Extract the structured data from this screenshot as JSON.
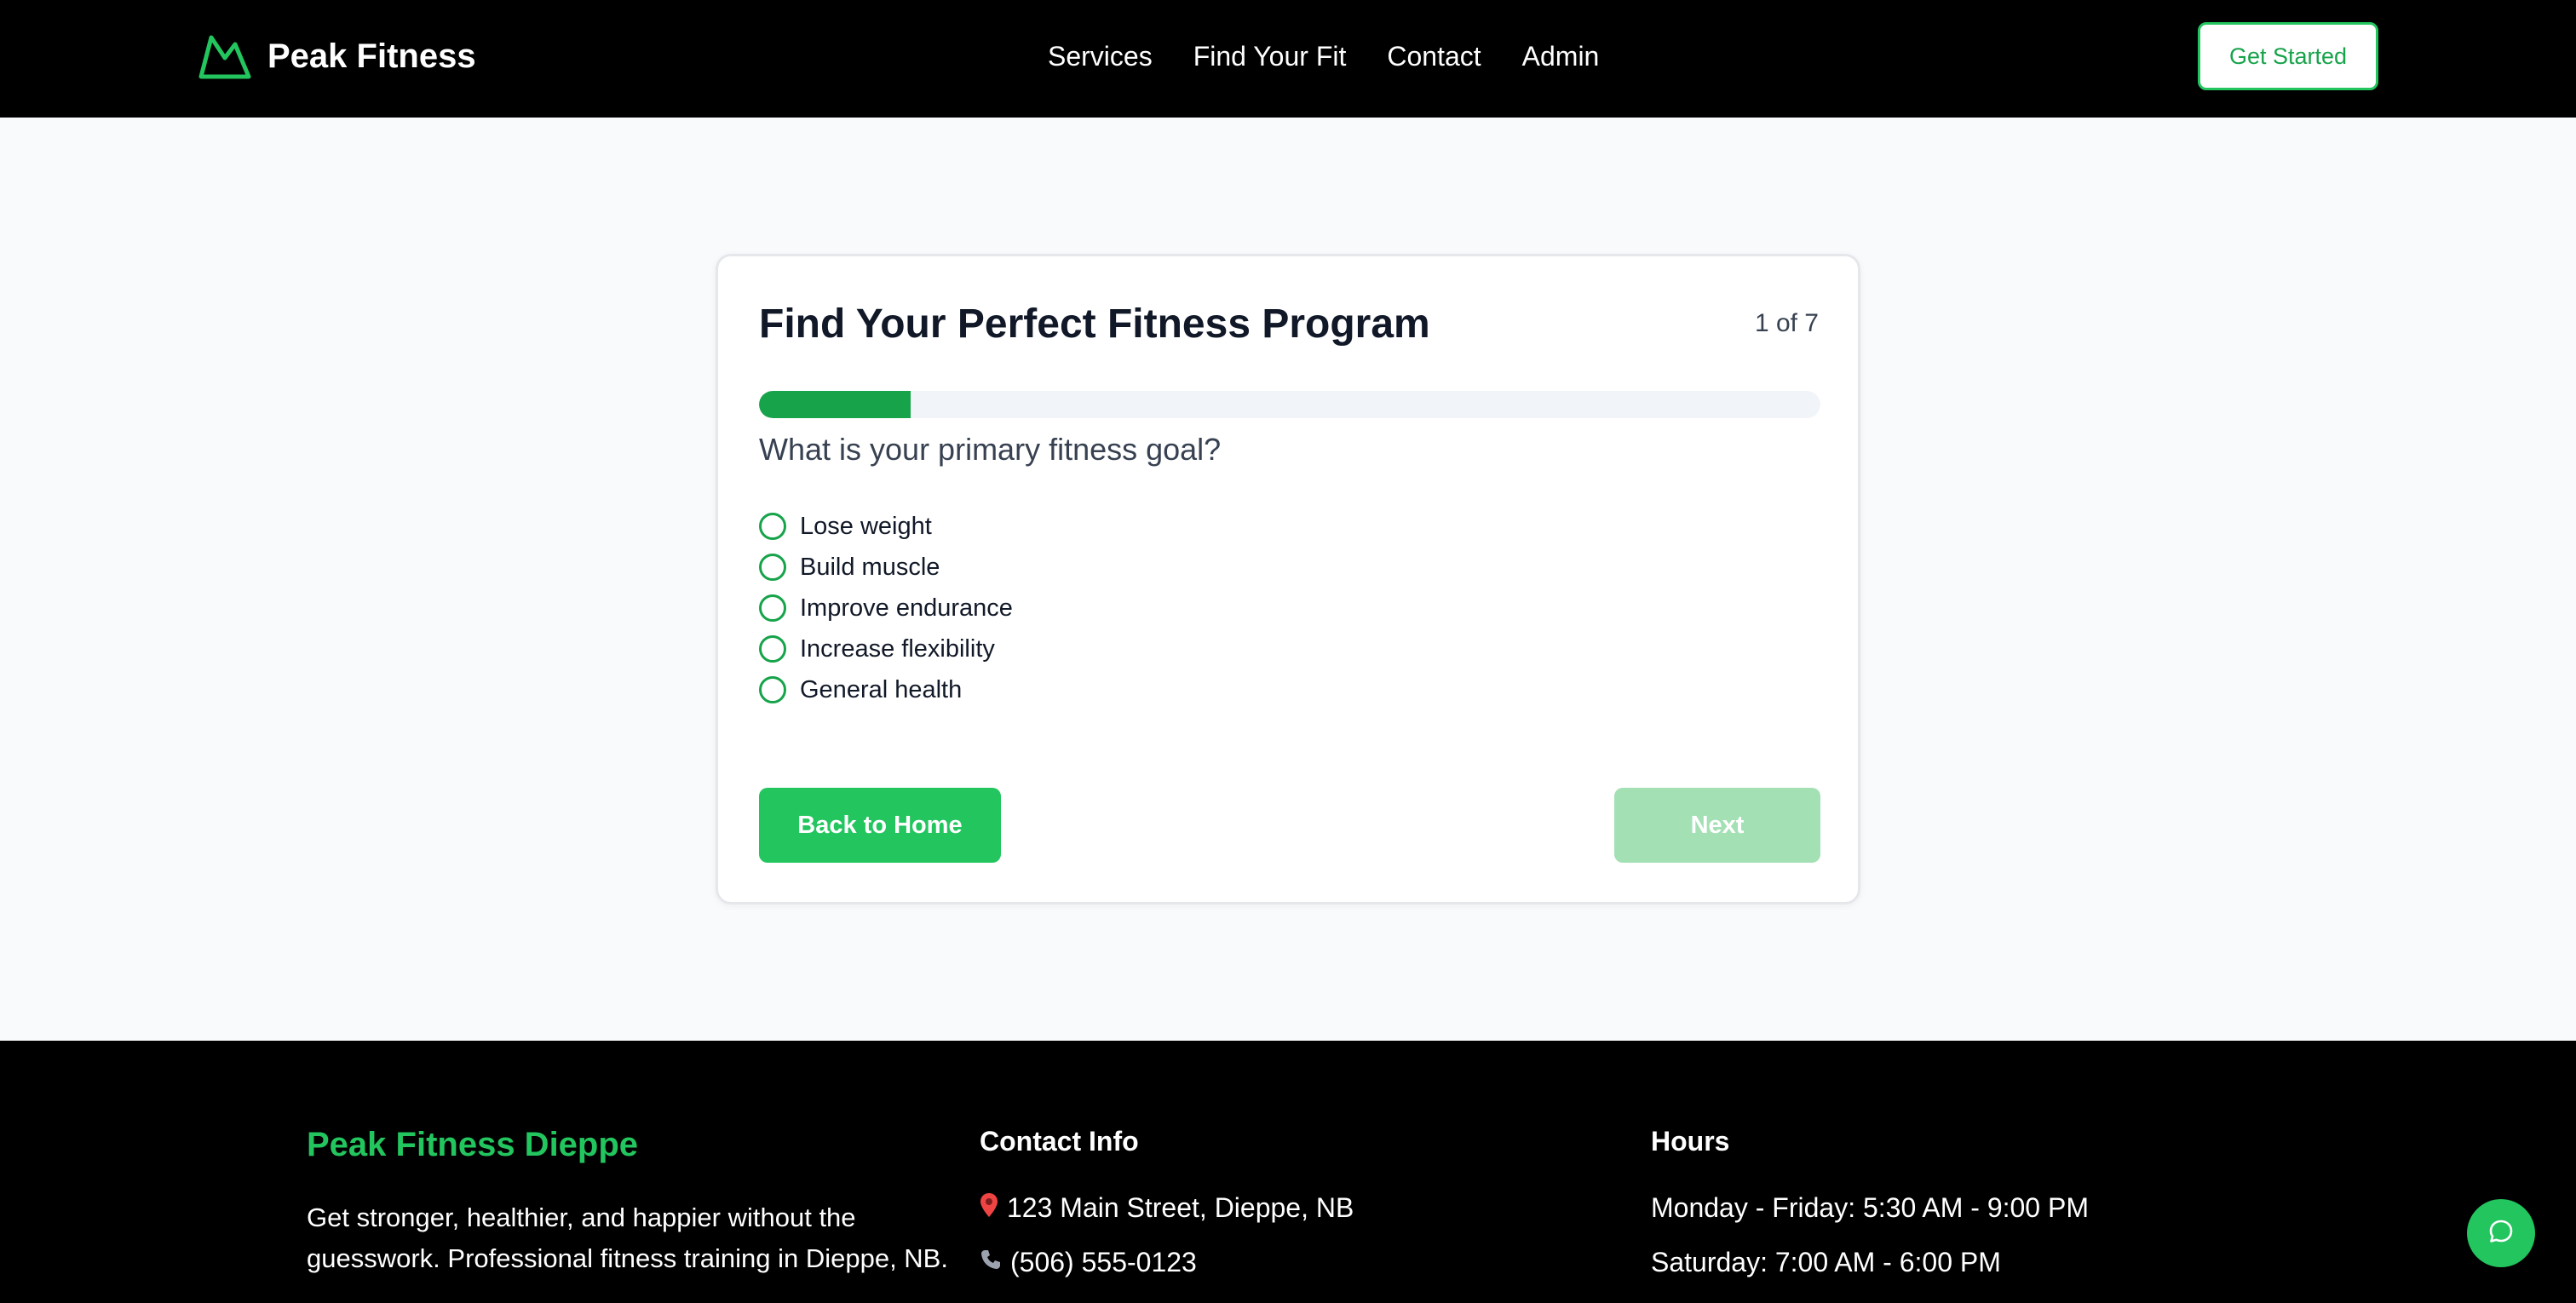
{
  "header": {
    "brand": "Peak Fitness",
    "nav": [
      "Services",
      "Find Your Fit",
      "Contact",
      "Admin"
    ],
    "cta": "Get Started"
  },
  "quiz": {
    "title": "Find Your Perfect Fitness Program",
    "step_counter": "1 of 7",
    "progress_fraction": 0.143,
    "question": "What is your primary fitness goal?",
    "options": [
      "Lose weight",
      "Build muscle",
      "Improve endurance",
      "Increase flexibility",
      "General health"
    ],
    "back_label": "Back to Home",
    "next_label": "Next"
  },
  "footer": {
    "brand": "Peak Fitness Dieppe",
    "description": "Get stronger, healthier, and happier without the guesswork. Professional fitness training in Dieppe, NB.",
    "contact_heading": "Contact Info",
    "address": "123 Main Street, Dieppe, NB",
    "phone": "(506) 555-0123",
    "hours_heading": "Hours",
    "hours": [
      "Monday - Friday: 5:30 AM - 9:00 PM",
      "Saturday: 7:00 AM - 6:00 PM"
    ]
  },
  "icons": {
    "logo": "mountain-icon",
    "address": "pin-icon",
    "phone": "phone-icon",
    "chat": "chat-bubble-icon"
  },
  "colors": {
    "accent": "#22c55e",
    "accent_dark": "#16a34a",
    "next_disabled": "#a3e0b4",
    "nav_bg": "#000000",
    "page_bg": "#f8fafc"
  }
}
